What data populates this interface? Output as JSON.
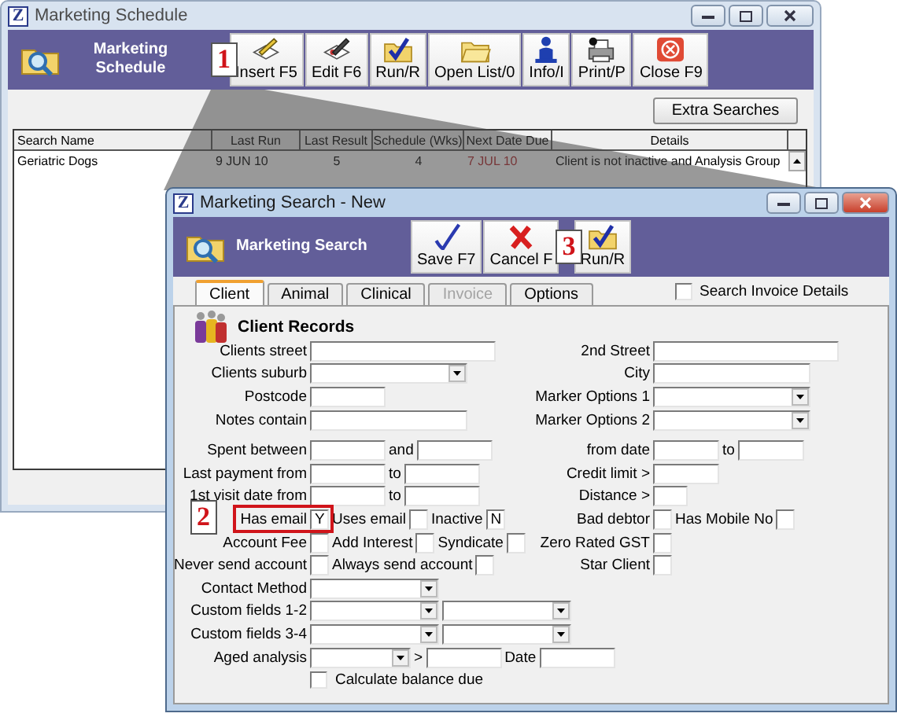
{
  "back_window": {
    "app_letter": "Z",
    "title": "Marketing Schedule",
    "heading": "Marketing Schedule",
    "toolbar": [
      {
        "kind": "callout",
        "text": "1"
      },
      {
        "kind": "button",
        "label": "Insert F5"
      },
      {
        "kind": "button",
        "label": "Edit F6"
      },
      {
        "kind": "button",
        "label": "Run/R"
      },
      {
        "kind": "button",
        "label": "Open List/0"
      },
      {
        "kind": "button",
        "label": "Info/I"
      },
      {
        "kind": "button",
        "label": "Print/P"
      },
      {
        "kind": "button",
        "label": "Close F9"
      }
    ],
    "extra_button": "Extra Searches",
    "table": {
      "columns": [
        "Search Name",
        "Last Run",
        "Last Result",
        "Schedule (Wks)",
        "Next Date Due",
        "Details"
      ],
      "rows": [
        {
          "cells": [
            "Geriatric Dogs",
            "9 JUN 10",
            "5",
            "4",
            "7 JUL 10",
            "Client is not inactive  and Analysis Group"
          ],
          "overdue": true
        }
      ]
    }
  },
  "front_window": {
    "app_letter": "Z",
    "title": "Marketing Search - New",
    "heading": "Marketing Search",
    "toolbar": [
      {
        "kind": "button",
        "label": "Save F7"
      },
      {
        "kind": "button",
        "label": "Cancel F"
      },
      {
        "kind": "callout",
        "text": "3"
      },
      {
        "kind": "button",
        "label": "Run/R"
      }
    ],
    "tabs": [
      {
        "label": "Client",
        "selected": true,
        "disabled": false
      },
      {
        "label": "Animal",
        "selected": false,
        "disabled": false
      },
      {
        "label": "Clinical",
        "selected": false,
        "disabled": false
      },
      {
        "label": "Invoice",
        "selected": false,
        "disabled": true
      },
      {
        "label": "Options",
        "selected": false,
        "disabled": false
      }
    ],
    "search_invoice_details": {
      "label": "Search Invoice Details",
      "checked": false
    },
    "form": {
      "title": "Client Records",
      "groups": [
        {
          "rows": [
            {
              "label": "Clients street",
              "items": [
                {
                  "kind": "longfield"
                }
              ],
              "right_label": "2nd Street",
              "right_items": [
                {
                  "kind": "longfield"
                }
              ]
            },
            {
              "label": "Clients suburb",
              "items": [
                {
                  "kind": "longselect"
                }
              ],
              "right_label": "City",
              "right_items": [
                {
                  "kind": "field"
                }
              ]
            },
            {
              "label": "Postcode",
              "items": [
                {
                  "kind": "shortfield"
                }
              ],
              "right_label": "Marker Options 1",
              "right_items": [
                {
                  "kind": "longselect"
                }
              ]
            },
            {
              "label": "Notes contain",
              "items": [
                {
                  "kind": "field"
                }
              ],
              "right_label": "Marker Options 2",
              "right_items": [
                {
                  "kind": "longselect"
                }
              ]
            }
          ]
        },
        {
          "rows": [
            {
              "label": "Spent between",
              "items": [
                {
                  "kind": "shortfield"
                },
                {
                  "kind": "label",
                  "text": "and"
                },
                {
                  "kind": "shortfield"
                }
              ],
              "right_label": "from date",
              "right_items": [
                {
                  "kind": "datefield"
                },
                {
                  "kind": "label",
                  "text": "to"
                },
                {
                  "kind": "datefield"
                }
              ]
            },
            {
              "label": "Last payment from",
              "items": [
                {
                  "kind": "shortfield"
                },
                {
                  "kind": "label",
                  "text": "to"
                },
                {
                  "kind": "shortfield"
                }
              ],
              "right_label": "Credit limit >",
              "right_items": [
                {
                  "kind": "datefield"
                }
              ]
            },
            {
              "label": "1st visit date from",
              "items": [
                {
                  "kind": "shortfield"
                },
                {
                  "kind": "label",
                  "text": "to"
                },
                {
                  "kind": "shortfield"
                }
              ],
              "right_label": "Distance >",
              "right_items": [
                {
                  "kind": "tinyfield"
                }
              ]
            },
            {
              "label": "Has email",
              "callout": "2",
              "items": [
                {
                  "kind": "box",
                  "value": "Y"
                },
                {
                  "kind": "label",
                  "text": "Uses email"
                },
                {
                  "kind": "box"
                },
                {
                  "kind": "label",
                  "text": "Inactive"
                },
                {
                  "kind": "box",
                  "value": "N"
                }
              ],
              "right_label": "Bad debtor",
              "right_items": [
                {
                  "kind": "box"
                },
                {
                  "kind": "label",
                  "text": "Has Mobile No"
                },
                {
                  "kind": "box"
                }
              ]
            },
            {
              "label": "Account Fee",
              "items": [
                {
                  "kind": "box"
                },
                {
                  "kind": "label",
                  "text": "Add Interest"
                },
                {
                  "kind": "box"
                },
                {
                  "kind": "label",
                  "text": "Syndicate"
                },
                {
                  "kind": "box"
                }
              ],
              "right_label": "Zero Rated GST",
              "right_items": [
                {
                  "kind": "box"
                }
              ]
            },
            {
              "label": "Never send account",
              "items": [
                {
                  "kind": "box"
                },
                {
                  "kind": "label",
                  "text": "Always send account"
                },
                {
                  "kind": "box"
                }
              ],
              "right_label": "Star Client",
              "right_items": [
                {
                  "kind": "box"
                }
              ]
            },
            {
              "label": "Contact Method",
              "items": [
                {
                  "kind": "select"
                }
              ]
            },
            {
              "label": "Custom fields 1-2",
              "items": [
                {
                  "kind": "select"
                },
                {
                  "kind": "select"
                }
              ]
            },
            {
              "label": "Custom fields 3-4",
              "items": [
                {
                  "kind": "select"
                },
                {
                  "kind": "select"
                }
              ]
            },
            {
              "label": "Aged analysis",
              "items": [
                {
                  "kind": "shortselect"
                },
                {
                  "kind": "label",
                  "text": ">"
                },
                {
                  "kind": "shortfield"
                },
                {
                  "kind": "label",
                  "text": "Date"
                },
                {
                  "kind": "shortfield"
                }
              ]
            },
            {
              "items": [
                {
                  "kind": "check",
                  "label": "Calculate balance due",
                  "checked": false
                }
              ]
            }
          ]
        }
      ]
    }
  }
}
